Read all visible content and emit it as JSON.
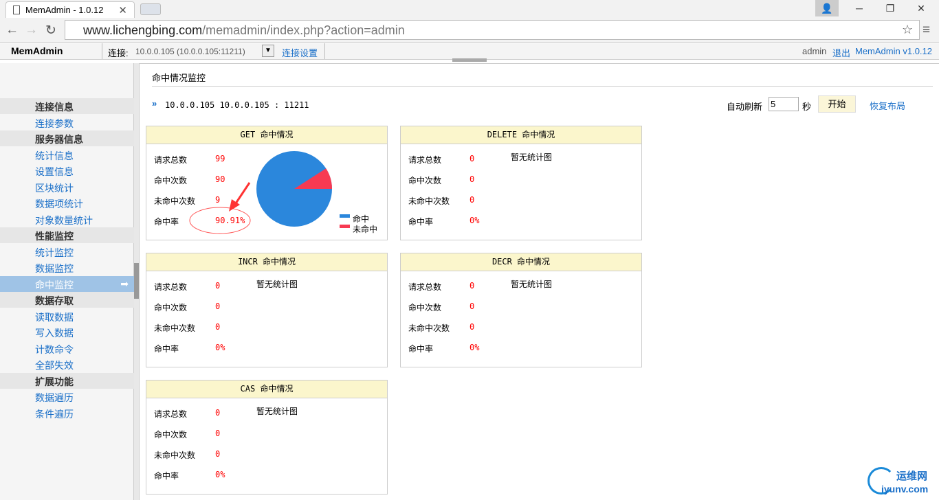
{
  "browser": {
    "tab_title": "MemAdmin - 1.0.12",
    "url_host": "www.lichengbing.com",
    "url_path": "/memadmin/index.php?action=admin"
  },
  "appbar": {
    "brand": "MemAdmin",
    "conn_label": "连接:",
    "conn_value": "10.0.0.105 (10.0.0.105:11211)",
    "conn_settings": "连接设置",
    "user": "admin",
    "logout": "退出",
    "version": "MemAdmin v1.0.12"
  },
  "sidebar": {
    "items": [
      {
        "label": "连接信息",
        "type": "grp"
      },
      {
        "label": "连接参数",
        "type": "lnk"
      },
      {
        "label": "服务器信息",
        "type": "grp"
      },
      {
        "label": "统计信息",
        "type": "lnk"
      },
      {
        "label": "设置信息",
        "type": "lnk"
      },
      {
        "label": "区块统计",
        "type": "lnk"
      },
      {
        "label": "数据项统计",
        "type": "lnk"
      },
      {
        "label": "对象数量统计",
        "type": "lnk"
      },
      {
        "label": "性能监控",
        "type": "grp"
      },
      {
        "label": "统计监控",
        "type": "lnk"
      },
      {
        "label": "数据监控",
        "type": "lnk"
      },
      {
        "label": "命中监控",
        "type": "act"
      },
      {
        "label": "数据存取",
        "type": "grp"
      },
      {
        "label": "读取数据",
        "type": "lnk"
      },
      {
        "label": "写入数据",
        "type": "lnk"
      },
      {
        "label": "计数命令",
        "type": "lnk"
      },
      {
        "label": "全部失效",
        "type": "lnk"
      },
      {
        "label": "扩展功能",
        "type": "grp"
      },
      {
        "label": "数据遍历",
        "type": "lnk"
      },
      {
        "label": "条件遍历",
        "type": "lnk"
      }
    ]
  },
  "main": {
    "title": "命中情况监控",
    "server": "10.0.0.105  10.0.0.105 : 11211",
    "refresh_label": "自动刷新",
    "refresh_value": "5",
    "seconds": "秒",
    "start": "开始",
    "reset_layout": "恢复布局"
  },
  "labels": {
    "total": "请求总数",
    "hits": "命中次数",
    "misses": "未命中次数",
    "rate": "命中率",
    "no_chart": "暂无统计图",
    "legend_hit": "命中",
    "legend_miss": "未命中"
  },
  "panels": [
    {
      "title": "GET 命中情况",
      "total": "99",
      "hits": "90",
      "misses": "9",
      "rate": "90.91%"
    },
    {
      "title": "DELETE 命中情况",
      "total": "0",
      "hits": "0",
      "misses": "0",
      "rate": "0%"
    },
    {
      "title": "INCR 命中情况",
      "total": "0",
      "hits": "0",
      "misses": "0",
      "rate": "0%"
    },
    {
      "title": "DECR 命中情况",
      "total": "0",
      "hits": "0",
      "misses": "0",
      "rate": "0%"
    },
    {
      "title": "CAS 命中情况",
      "total": "0",
      "hits": "0",
      "misses": "0",
      "rate": "0%"
    }
  ],
  "colors": {
    "hit": "#2b87dc",
    "miss": "#f73a52"
  },
  "watermark": {
    "cn": "运维网",
    "en": "iyunv.com"
  }
}
